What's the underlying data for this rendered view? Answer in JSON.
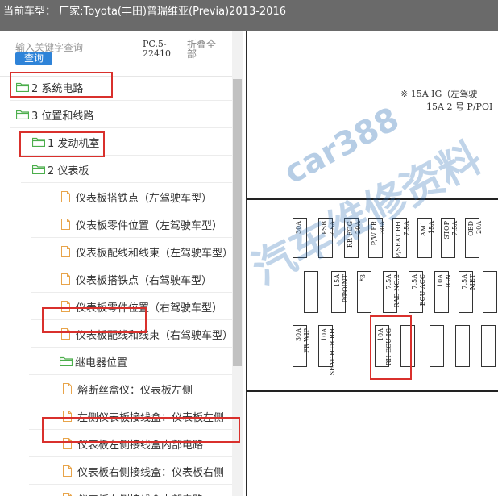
{
  "header": {
    "title": "当前车型：  厂家:Toyota(丰田)普瑞维亚(Previa)2013-2016"
  },
  "search": {
    "placeholder": "输入关键字查询",
    "button_label": "查询",
    "pc_label": "PC.5-22410",
    "collapse_label": "折叠全部"
  },
  "tree": {
    "items": [
      {
        "label": "2 系统电路",
        "kind": "folder",
        "highlighted": false
      },
      {
        "label": "3 位置和线路",
        "kind": "folder",
        "highlighted": true
      },
      {
        "label": "1 发动机室",
        "kind": "folder",
        "highlighted": false
      },
      {
        "label": "2 仪表板",
        "kind": "folder",
        "highlighted": true
      },
      {
        "label": "仪表板搭铁点（左驾驶车型）",
        "kind": "doc",
        "highlighted": false
      },
      {
        "label": "仪表板零件位置（左驾驶车型）",
        "kind": "doc",
        "highlighted": false
      },
      {
        "label": "仪表板配线和线束（左驾驶车型）",
        "kind": "doc",
        "highlighted": false
      },
      {
        "label": "仪表板搭铁点（右驾驶车型）",
        "kind": "doc",
        "highlighted": false
      },
      {
        "label": "仪表板零件位置（右驾驶车型）",
        "kind": "doc",
        "highlighted": false
      },
      {
        "label": "仪表板配线和线束（右驾驶车型）",
        "kind": "doc",
        "highlighted": false
      },
      {
        "label": "继电器位置",
        "kind": "folder",
        "highlighted": true
      },
      {
        "label": "熔断丝盒仪：仪表板左侧",
        "kind": "doc",
        "highlighted": false
      },
      {
        "label": "左侧仪表板接线盒：仪表板左侧",
        "kind": "doc",
        "highlighted": false
      },
      {
        "label": "仪表板左侧接线盒内部电路",
        "kind": "doc",
        "highlighted": false
      },
      {
        "label": "仪表板右侧接线盒：仪表板右侧",
        "kind": "doc",
        "highlighted": true
      },
      {
        "label": "仪表板右侧接线盒内部电路",
        "kind": "doc",
        "highlighted": false
      }
    ]
  },
  "viewer": {
    "top_note_line1": "※ 15A  IG（左驾驶",
    "top_note_line2": "15A 2 号 P/POI",
    "watermark_main": "汽车维修资料",
    "watermark_site": "car388",
    "row1": [
      "30A",
      "PSB",
      "7.5A",
      "RR FOG",
      "20A",
      "P/W FR",
      "30A",
      "P/SEAT RH",
      "7.5A",
      "AM1",
      "15A",
      "STOP",
      "7.5A",
      "OBD",
      "20A"
    ],
    "row2": [
      "15A",
      "P/POINT",
      "*3",
      "7.5A",
      "RAD NO.2",
      "7.5A",
      "ECU-ACC",
      "10A",
      "IGN",
      "7.5A",
      "MET"
    ],
    "row3": [
      "30A",
      "FR WIP",
      "10A",
      "SEAT HTR RH",
      "10A",
      "RH ECU-IG"
    ],
    "colors": {
      "highlight": "#d9302c",
      "accent": "#2e83d8",
      "folder": "#4cae4c",
      "doc": "#e8a44a",
      "watermark": "#2e6fb5"
    }
  }
}
